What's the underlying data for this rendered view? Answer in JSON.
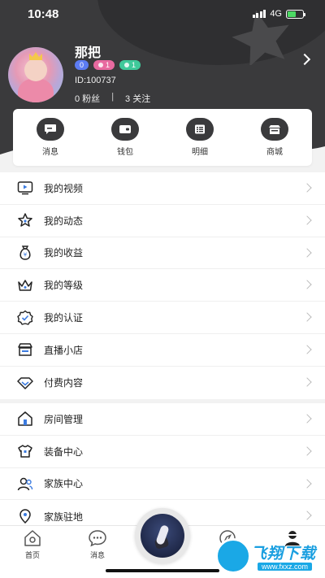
{
  "status_bar": {
    "time": "10:48",
    "network": "4G",
    "battery_level": 0.55
  },
  "profile": {
    "username": "那把",
    "badges": [
      "0",
      "1",
      "1"
    ],
    "id_text": "ID:100737",
    "fans": "0 粉丝",
    "separator": "|",
    "following": "3 关注"
  },
  "quick_actions": [
    {
      "label": "消息",
      "icon": "chat-icon"
    },
    {
      "label": "钱包",
      "icon": "wallet-icon"
    },
    {
      "label": "明细",
      "icon": "list-icon"
    },
    {
      "label": "商城",
      "icon": "shop-icon"
    }
  ],
  "menu_section_1": [
    {
      "label": "我的视频",
      "icon": "video-icon"
    },
    {
      "label": "我的动态",
      "icon": "star-icon"
    },
    {
      "label": "我的收益",
      "icon": "money-bag-icon"
    },
    {
      "label": "我的等级",
      "icon": "crown-icon"
    },
    {
      "label": "我的认证",
      "icon": "verified-icon"
    },
    {
      "label": "直播小店",
      "icon": "store-icon"
    },
    {
      "label": "付费内容",
      "icon": "diamond-icon"
    }
  ],
  "menu_section_2": [
    {
      "label": "房间管理",
      "icon": "house-icon"
    },
    {
      "label": "装备中心",
      "icon": "shirt-icon"
    },
    {
      "label": "家族中心",
      "icon": "people-icon"
    },
    {
      "label": "家族驻地",
      "icon": "location-icon"
    }
  ],
  "tab_bar": {
    "home": "首页",
    "messages": "消息"
  },
  "watermark": {
    "text": "飞翔下载",
    "url": "www.fxxz.com"
  },
  "colors": {
    "header_bg": "#3a3a3c",
    "accent_dark": "#3a3a3c",
    "page_bg": "#f2f2f2"
  }
}
